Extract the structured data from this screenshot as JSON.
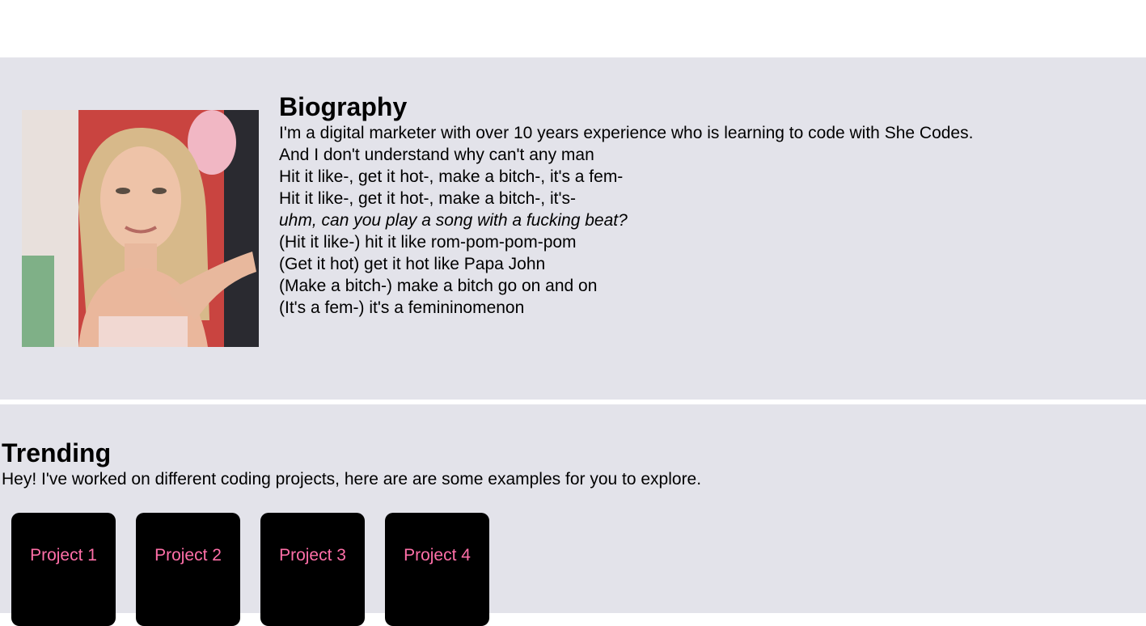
{
  "biography": {
    "title": "Biography",
    "lines": [
      "I'm a digital marketer with over 10 years experience who is learning to code with She Codes.",
      "And I don't understand why can't any man",
      "Hit it like-, get it hot-, make a bitch-, it's a fem-",
      "Hit it like-, get it hot-, make a bitch-, it's-",
      "uhm, can you play a song with a fucking beat?",
      "(Hit it like-) hit it like rom-pom-pom-pom",
      "(Get it hot) get it hot like Papa John",
      "(Make a bitch-) make a bitch go on and on",
      "(It's a fem-) it's a femininomenon"
    ]
  },
  "trending": {
    "title": "Trending",
    "subtitle": "Hey! I've worked on different coding projects, here are are some examples for you to explore.",
    "projects": [
      {
        "label": "Project 1"
      },
      {
        "label": "Project 2"
      },
      {
        "label": "Project 3"
      },
      {
        "label": "Project 4"
      }
    ]
  },
  "colors": {
    "section_bg": "#e3e3ea",
    "card_bg": "#000000",
    "card_text": "#ff6fa8"
  }
}
